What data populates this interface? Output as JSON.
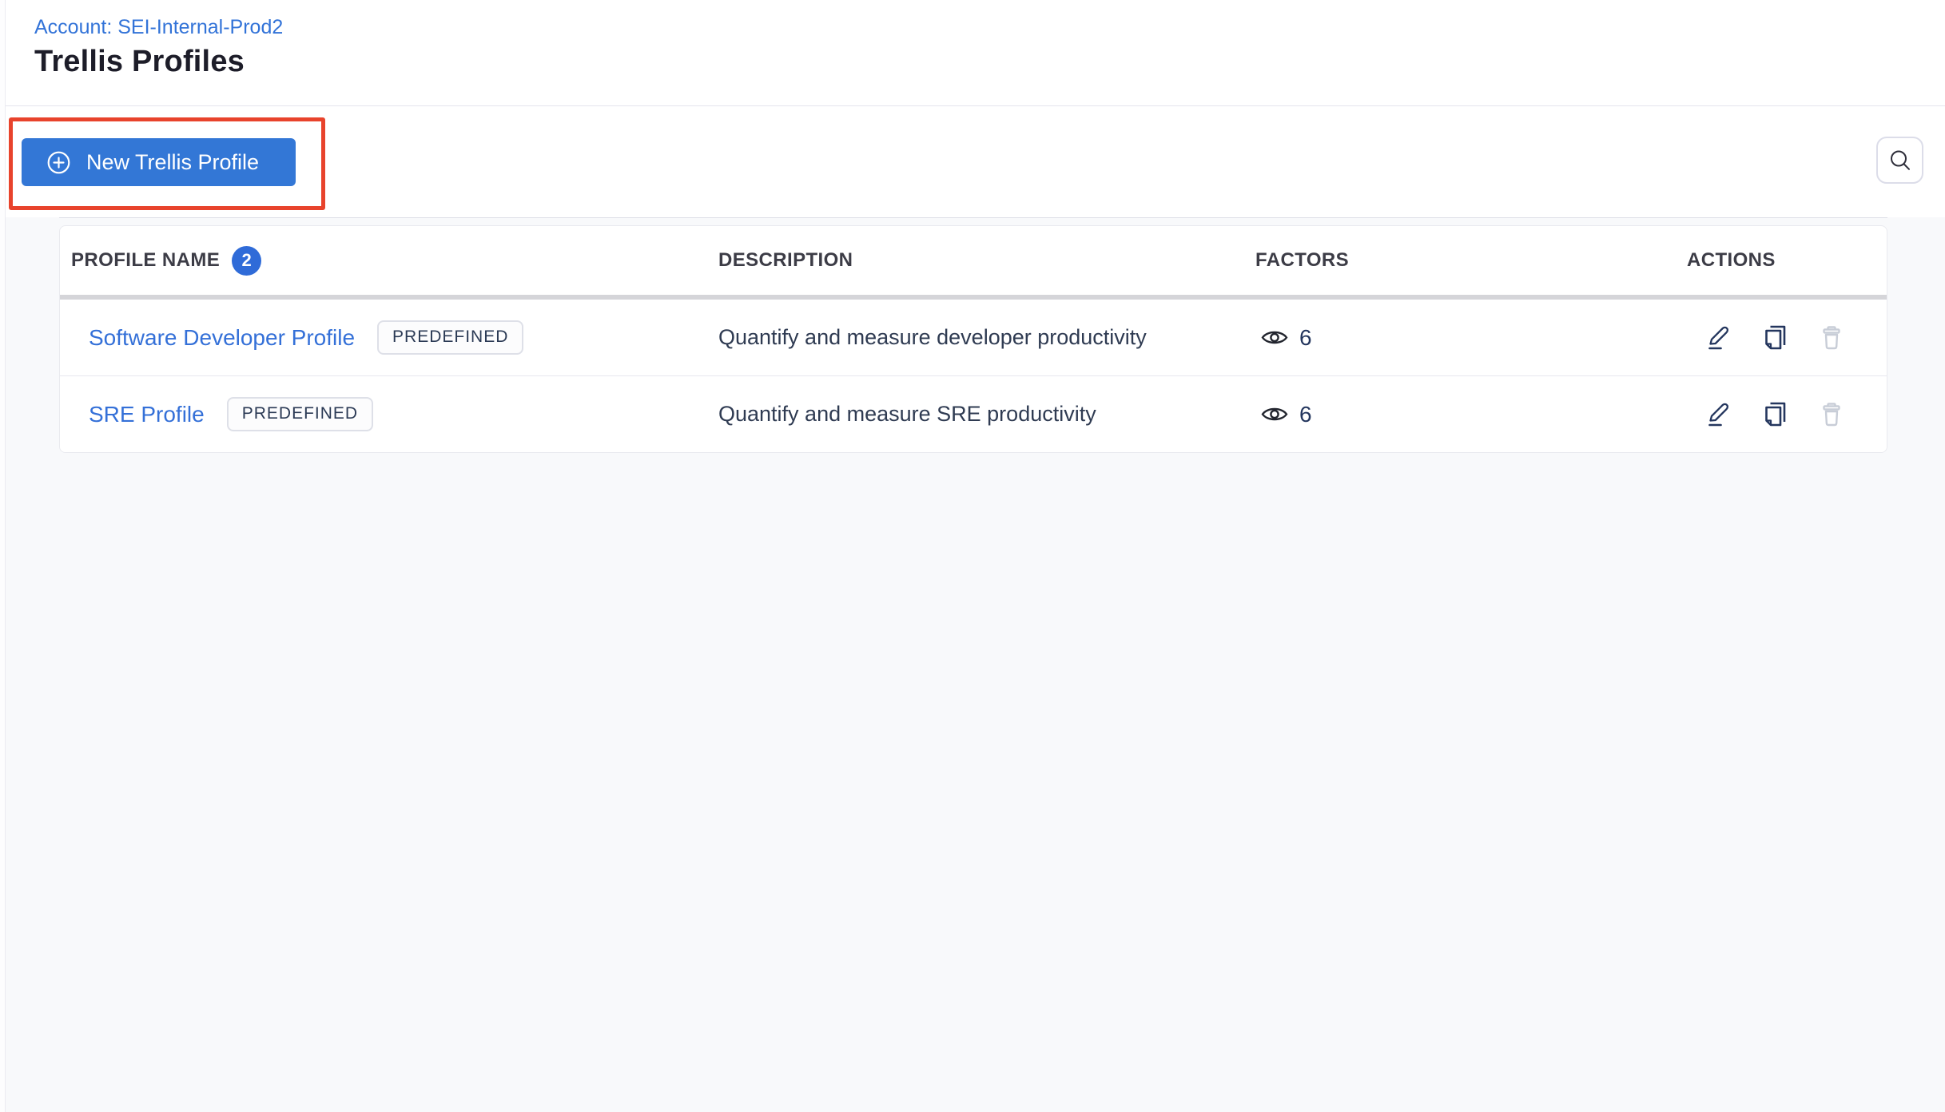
{
  "header": {
    "account_breadcrumb": "Account: SEI-Internal-Prod2",
    "title": "Trellis Profiles"
  },
  "toolbar": {
    "new_profile_button_label": "New Trellis Profile"
  },
  "table": {
    "columns": [
      "PROFILE NAME",
      "DESCRIPTION",
      "FACTORS",
      "ACTIONS"
    ],
    "profile_count": "2",
    "rows": [
      {
        "name": "Software Developer Profile",
        "badge": "PREDEFINED",
        "description": "Quantify and measure developer productivity",
        "factors_count": "6"
      },
      {
        "name": "SRE Profile",
        "badge": "PREDEFINED",
        "description": "Quantify and measure SRE productivity",
        "factors_count": "6"
      }
    ]
  },
  "icons": {
    "new_button_icon": "plus-circle",
    "search_icon": "magnifier",
    "factors_icon": "eye",
    "row_actions": [
      "edit-pencil",
      "clone-copy",
      "delete-trash"
    ]
  },
  "colors": {
    "primary_button_blue": "#3377d6",
    "link_blue": "#3470d8",
    "count_badge_blue": "#2f6bd8",
    "annotation_red": "#e8432c",
    "title_text": "#1d1d29",
    "body_text_navy": "#2f3b52",
    "action_icon_navy": "#24365e",
    "disabled_icon_gray": "#c8cdd7",
    "content_background": "#f8f9fb"
  }
}
